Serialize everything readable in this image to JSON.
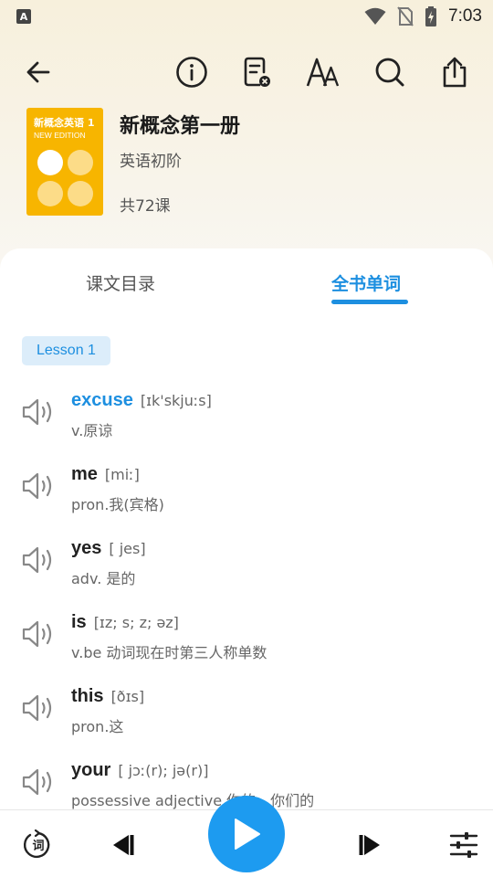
{
  "status": {
    "time": "7:03",
    "left_badge": "A"
  },
  "toolbar": {
    "back_icon": "arrow-left-icon",
    "info_icon": "info-icon",
    "clear_notes_icon": "note-clear-icon",
    "font_icon": "font-size-icon",
    "search_icon": "search-icon",
    "share_icon": "share-icon"
  },
  "book": {
    "cover_title": "新概念英语 1",
    "cover_subtitle": "NEW EDITION",
    "title": "新概念第一册",
    "level": "英语初阶",
    "lesson_count": "共72课"
  },
  "tabs": [
    {
      "label": "课文目录",
      "active": false
    },
    {
      "label": "全书单词",
      "active": true
    }
  ],
  "lesson_chip": "Lesson 1",
  "words": [
    {
      "word": "excuse",
      "phonetic": "[ɪk'skjuːs]",
      "meaning": "v.原谅",
      "active": true
    },
    {
      "word": "me",
      "phonetic": "[miː]",
      "meaning": "pron.我(宾格)",
      "active": false
    },
    {
      "word": "yes",
      "phonetic": "[ jes]",
      "meaning": "adv. 是的",
      "active": false
    },
    {
      "word": "is",
      "phonetic": "[ɪz; s; z; əz]",
      "meaning": "v.be 动词现在时第三人称单数",
      "active": false
    },
    {
      "word": "this",
      "phonetic": "[ðɪs]",
      "meaning": "pron.这",
      "active": false
    },
    {
      "word": "your",
      "phonetic": "[ jɔː(r); jə(r)]",
      "meaning": "possessive adjective 你的，你们的",
      "active": false
    }
  ],
  "colors": {
    "accent": "#1d8fe0",
    "play_button": "#1d9bf0",
    "cover": "#f7b500",
    "chip_bg": "#dcedfa"
  },
  "bottom_bar": {
    "word_mode_icon": "word-mode-icon",
    "word_mode_glyph": "词",
    "prev_icon": "skip-previous-icon",
    "play_icon": "play-icon",
    "next_icon": "skip-next-icon",
    "settings_icon": "sliders-icon"
  }
}
